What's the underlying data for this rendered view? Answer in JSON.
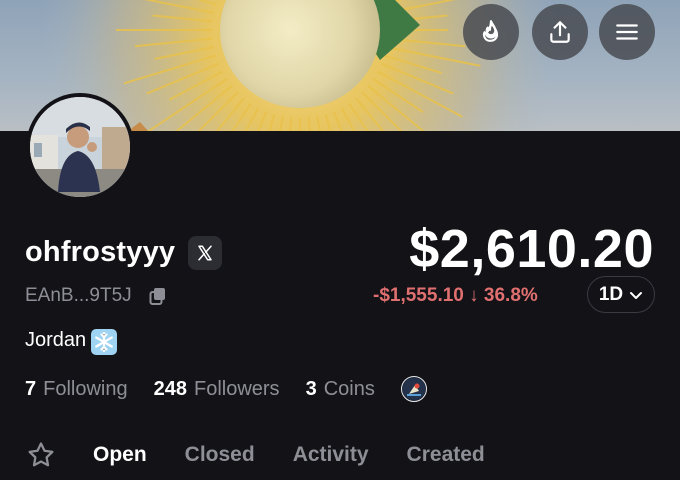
{
  "header": {
    "buttons": [
      {
        "name": "fire",
        "icon": "flame-icon"
      },
      {
        "name": "share",
        "icon": "share-icon"
      },
      {
        "name": "menu",
        "icon": "hamburger-menu-icon"
      }
    ]
  },
  "profile": {
    "username": "ohfrostyyy",
    "social_badge_icon": "x-logo-icon",
    "address": "EAnB...9T5J",
    "bio": "Jordan",
    "bio_emoji_icon": "snowflake-icon"
  },
  "portfolio": {
    "balance": "$2,610.20",
    "change": "-$1,555.10 ↓ 36.8%",
    "range": "1D"
  },
  "stats": {
    "following_count": "7",
    "following_label": "Following",
    "followers_count": "248",
    "followers_label": "Followers",
    "coins_count": "3",
    "coins_label": "Coins"
  },
  "tabs": [
    {
      "label": "Open",
      "active": true
    },
    {
      "label": "Closed",
      "active": false
    },
    {
      "label": "Activity",
      "active": false
    },
    {
      "label": "Created",
      "active": false
    }
  ],
  "colors": {
    "background": "#121217",
    "negative": "#e07070",
    "muted_text": "#8e8e96"
  }
}
